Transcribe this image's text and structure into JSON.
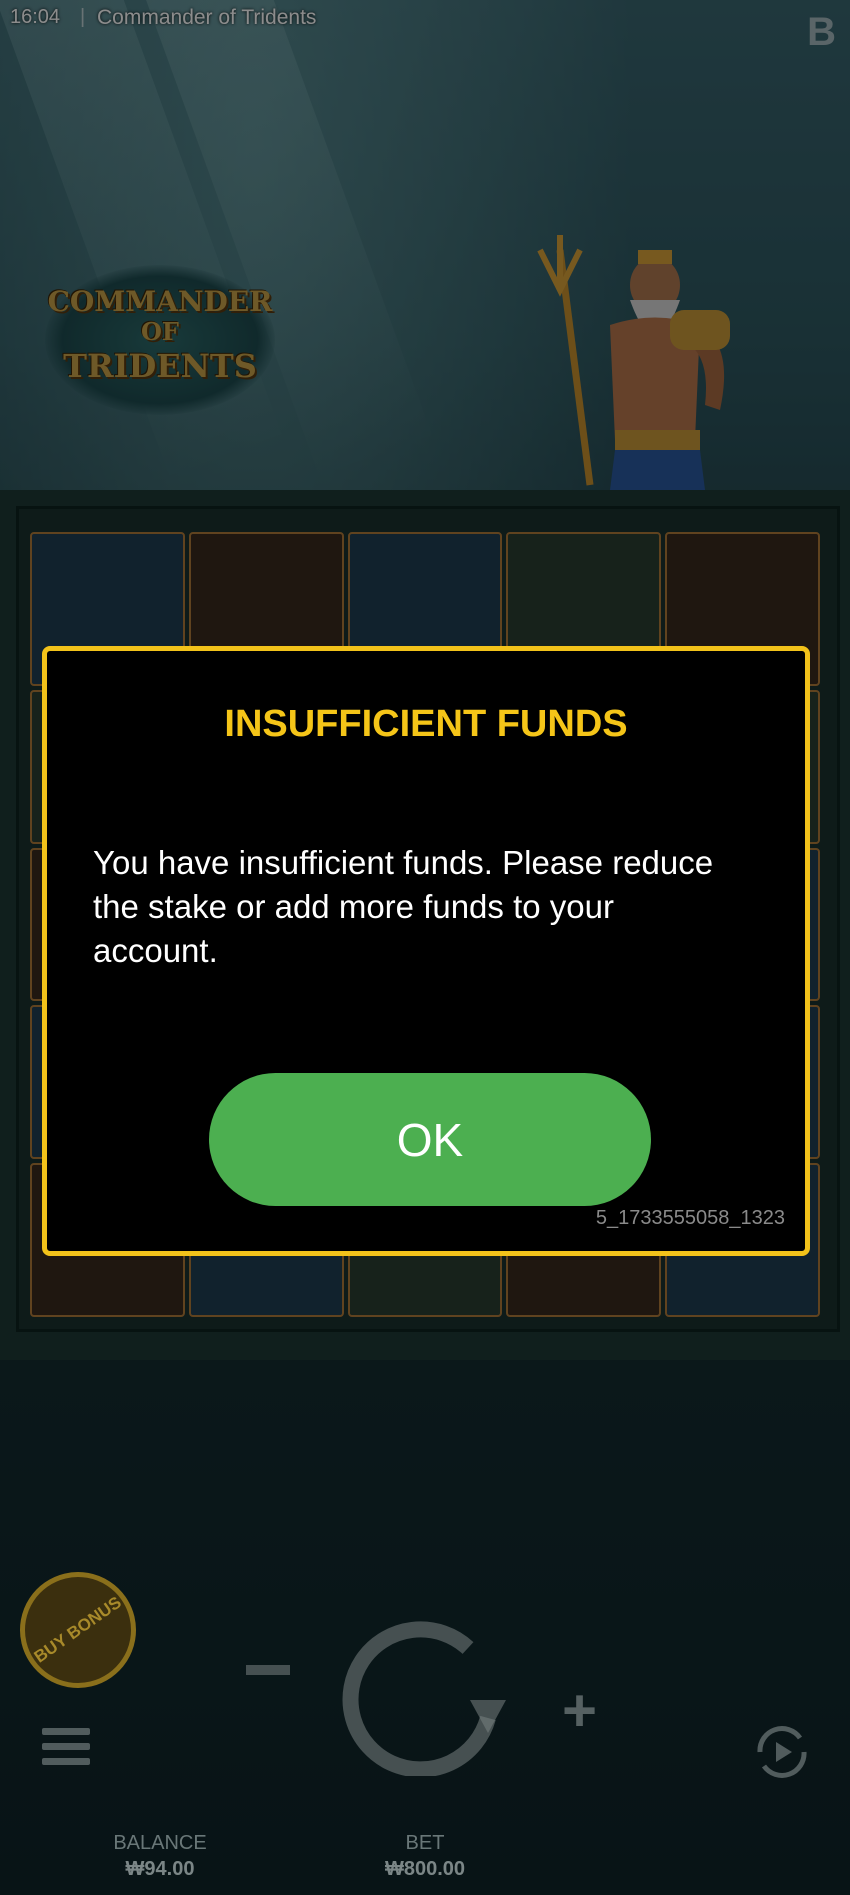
{
  "topbar": {
    "time": "16:04",
    "separator": "|",
    "game_title": "Commander of Tridents",
    "brand_letter": "B"
  },
  "logo": {
    "line1": "COMMANDER",
    "line2": "OF",
    "line3": "TRIDENTS"
  },
  "modal": {
    "title": "INSUFFICIENT FUNDS",
    "message": "You have insufficient funds. Please reduce the stake or add more funds to your account.",
    "ok_label": "OK",
    "code": "5_1733555058_1323"
  },
  "controls": {
    "buy_bonus_label": "BUY BONUS",
    "minus_label": "−",
    "plus_label": "+",
    "balance_label": "BALANCE",
    "balance_value": "₩94.00",
    "bet_label": "BET",
    "bet_value": "₩800.00"
  },
  "colors": {
    "accent_yellow": "#f2c21a",
    "ok_green": "#4caf50"
  }
}
